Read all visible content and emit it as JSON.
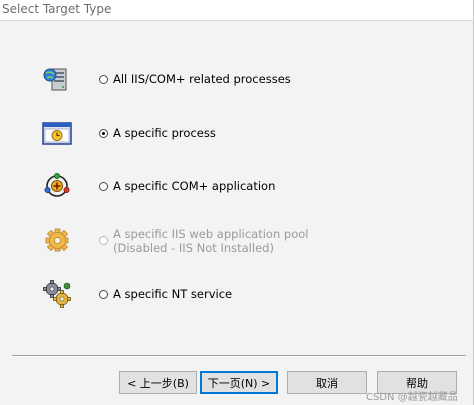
{
  "window": {
    "title": "Select Target Type"
  },
  "options": [
    {
      "label": "All IIS/COM+ related processes",
      "checked": false,
      "enabled": true,
      "icon": "server-icon"
    },
    {
      "label": "A specific process",
      "checked": true,
      "enabled": true,
      "icon": "process-window-icon"
    },
    {
      "label": "A specific COM+ application",
      "checked": false,
      "enabled": true,
      "icon": "com-plus-icon"
    },
    {
      "label": "A specific IIS web application pool",
      "label2": "(Disabled - IIS Not Installed)",
      "checked": false,
      "enabled": false,
      "icon": "app-pool-gear-icon"
    },
    {
      "label": "A specific NT service",
      "checked": false,
      "enabled": true,
      "icon": "nt-service-gears-icon"
    }
  ],
  "buttons": {
    "back": "< 上一步(B)",
    "next": "下一页(N) >",
    "cancel": "取消",
    "help": "帮助"
  },
  "watermark": "CSDN @越瓷越藏品",
  "colors": {
    "background": "#f3f3f3",
    "accent": "#0078d7",
    "disabled_text": "#9a9a9a"
  }
}
